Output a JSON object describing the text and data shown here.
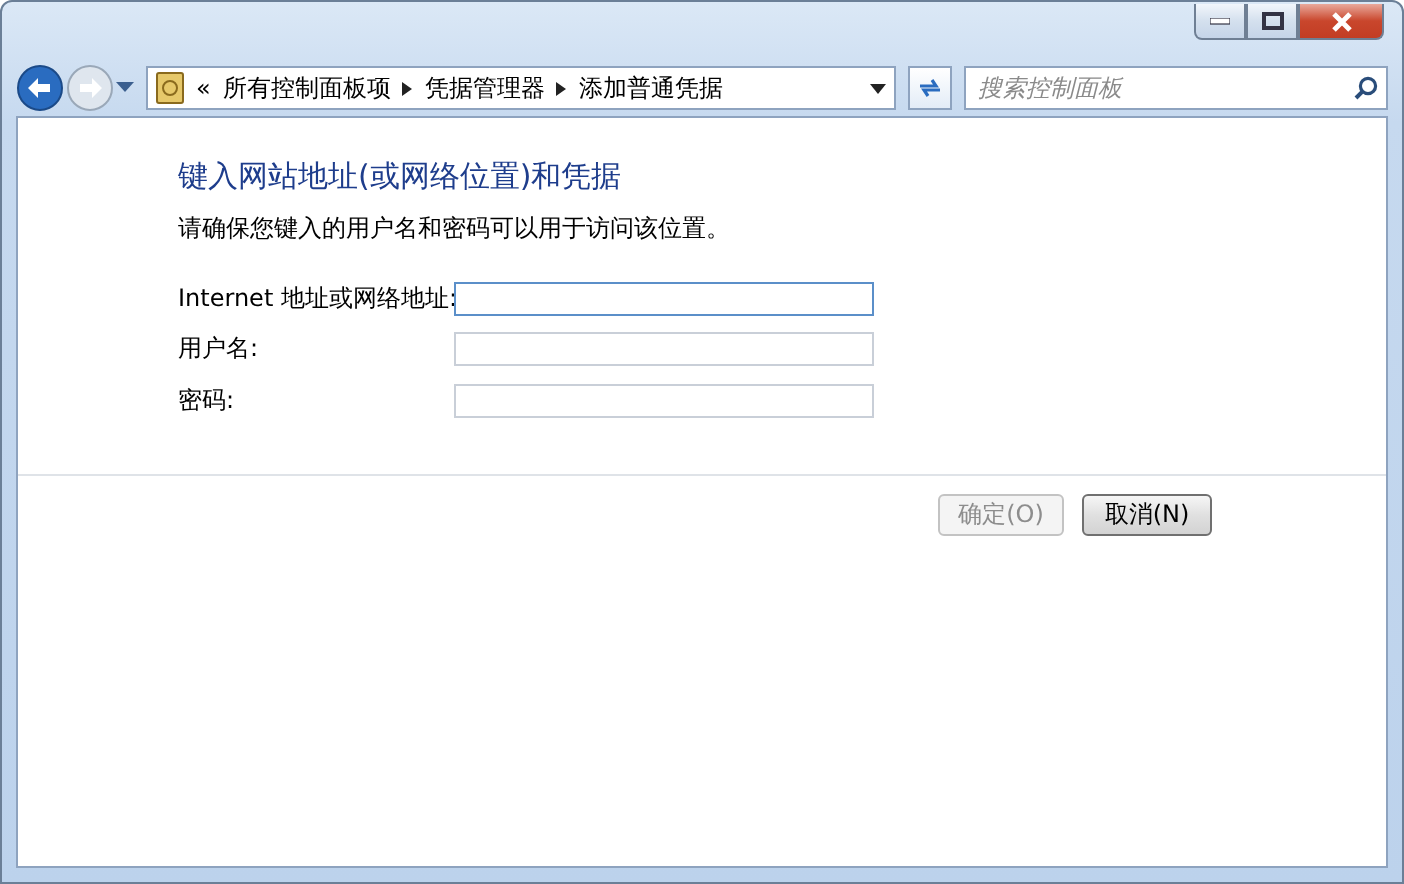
{
  "address_bar": {
    "overflow": "«",
    "crumbs": [
      "所有控制面板项",
      "凭据管理器",
      "添加普通凭据"
    ]
  },
  "search": {
    "placeholder": "搜索控制面板"
  },
  "heading": "键入网站地址(或网络位置)和凭据",
  "description": "请确保您键入的用户名和密码可以用于访问该位置。",
  "fields": [
    {
      "label": "Internet 地址或网络地址:",
      "focused": true
    },
    {
      "label": "用户名:",
      "focused": false
    },
    {
      "label": "密码:",
      "focused": false
    }
  ],
  "buttons": [
    {
      "label": "确定(O)",
      "disabled": true
    },
    {
      "label": "取消(N)",
      "disabled": false
    }
  ]
}
